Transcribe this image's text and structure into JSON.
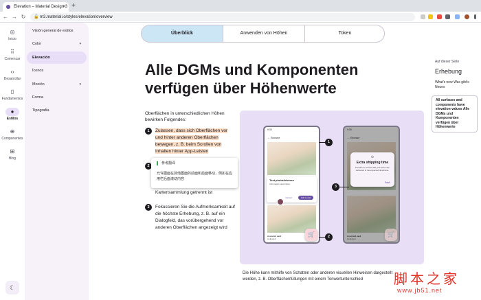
{
  "browser": {
    "tab_title": "Elevation – Material Design 3",
    "tab_close": "✕",
    "new_tab": "+",
    "url": "m3.material.io/styles/elevation/overview"
  },
  "rail": {
    "items": [
      {
        "label": "Inicio",
        "icon": "home-icon",
        "glyph": "◎"
      },
      {
        "label": "Comenzar",
        "icon": "apps-icon",
        "glyph": "⠿"
      },
      {
        "label": "Desarrollar",
        "icon": "code-icon",
        "glyph": "‹›"
      },
      {
        "label": "Fundamentos",
        "icon": "book-icon",
        "glyph": "▯"
      },
      {
        "label": "Estilos",
        "icon": "palette-icon",
        "glyph": "●"
      },
      {
        "label": "Componentes",
        "icon": "components-icon",
        "glyph": "⊕"
      },
      {
        "label": "Blog",
        "icon": "blog-icon",
        "glyph": "⊞"
      }
    ],
    "theme_glyph": "☾"
  },
  "subnav": {
    "items": [
      {
        "label": "Visión general de estilos"
      },
      {
        "label": "Color",
        "chevron": "▾"
      },
      {
        "label": "Elevación"
      },
      {
        "label": "Íconos"
      },
      {
        "label": "Moción",
        "chevron": "▾"
      },
      {
        "label": "Forma"
      },
      {
        "label": "Tipografía"
      }
    ]
  },
  "main": {
    "tabs": [
      {
        "label": "Überblick"
      },
      {
        "label": "Anwenden von Höhen"
      },
      {
        "label": "Token"
      }
    ],
    "title": "Alle DGMs und Komponenten verfügen über Höhenwerte",
    "intro": "Oberflächen in unterschiedlichen Höhen bewirken Folgendes:",
    "points": [
      {
        "num": "1",
        "text": "Zulassen, dass sich Oberflächen vor und hinter anderen Oberflächen bewegen, z. B. beim Scrollen von Inhalten hinter App-Leisten"
      },
      {
        "num": "2",
        "text": "Kartensammlung getrennt ist"
      },
      {
        "num": "3",
        "text": "Fokussieren Sie die Aufmerksamkeit auf die höchste Erhebung, z. B. auf ein Dialogfeld, das vorübergehend vor anderen Oberflächen angezeigt wird"
      }
    ],
    "translate_popup": {
      "header": "参考翻译",
      "body": "允许图面在其他图面的前面和后面移动，例如在应用栏后面滚动内容"
    },
    "caption": "Die Höhe kann mithilfe von Schatten oder anderen visuellen Hinweisen dargestellt werden, z. B. Oberflächenfüllungen mit einem Tonwertunterschied"
  },
  "figure": {
    "phone1": {
      "time": "9:30",
      "bar_title": "Browse",
      "card_title": "Test photoAdverse",
      "card_sub": "Information description",
      "chip1": "Cancel",
      "chip2": "Add to cart",
      "item_title": "Assorted card",
      "item_sub": "Collected"
    },
    "phone2": {
      "time": "9:30",
      "bar_title": "Browse",
      "dialog_title": "Extra shipping time",
      "dialog_body": "Prepare to ensure that your items are delivered in the expected timeframe.",
      "dialog_action": "Back",
      "item_title": "Assorted card",
      "item_sub": "Collected"
    },
    "callouts": [
      "1",
      "2",
      "3"
    ],
    "fab_glyph": "🛒"
  },
  "toc": {
    "label": "Auf dieser Seite",
    "links": [
      "Erhebung",
      "What's new Was gibt's Neues"
    ],
    "active": "All surfaces and components have elevation values Alle DGMs und Komponenten verfügen über Höhenwerte"
  },
  "watermark": {
    "text": "脚本之家",
    "url": "www.jb51.net"
  }
}
